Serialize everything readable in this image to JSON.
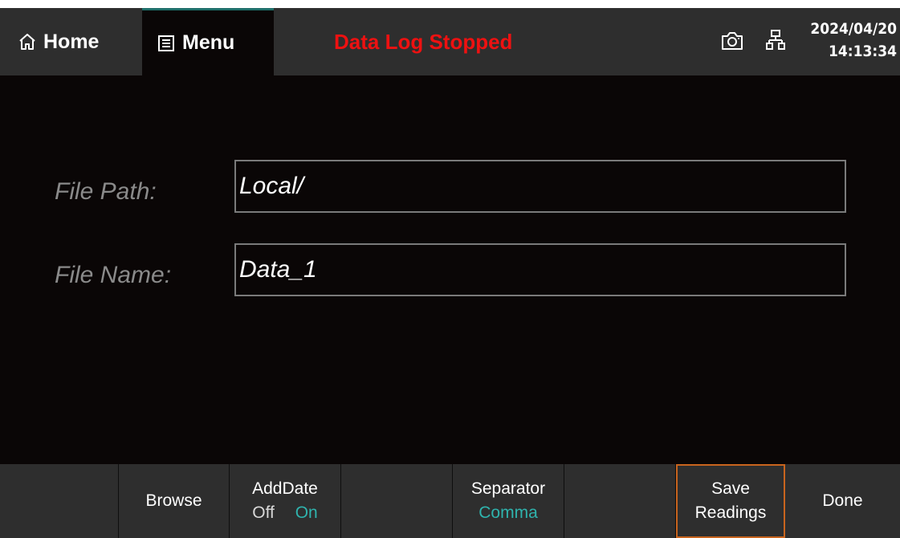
{
  "header": {
    "home_label": "Home",
    "menu_label": "Menu",
    "status": "Data Log Stopped",
    "date": "2024/04/20",
    "time": "14:13:34"
  },
  "form": {
    "file_path_label": "File Path:",
    "file_path_value": "Local/",
    "file_name_label": "File Name:",
    "file_name_value": "Data_1"
  },
  "softkeys": {
    "browse": "Browse",
    "adddate_label": "AddDate",
    "adddate_off": "Off",
    "adddate_on": "On",
    "separator_label": "Separator",
    "separator_value": "Comma",
    "save_line1": "Save",
    "save_line2": "Readings",
    "done": "Done"
  },
  "colors": {
    "status": "#ee1111",
    "accent": "#2fb3ad",
    "highlight_border": "#c8641e"
  },
  "icons": [
    "home-icon",
    "menu-list-icon",
    "camera-icon",
    "network-icon"
  ]
}
